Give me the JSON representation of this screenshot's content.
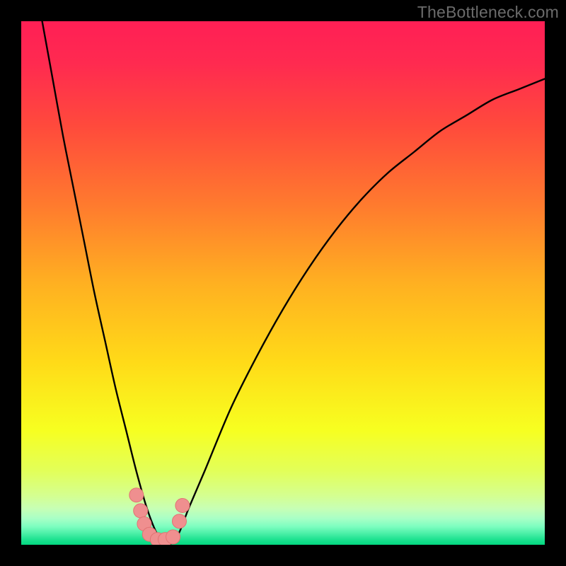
{
  "watermark": "TheBottleneck.com",
  "colors": {
    "frame": "#000000",
    "watermark": "#6b6b6b",
    "curve": "#000000",
    "marker_fill": "#ef8f8f",
    "marker_stroke": "#e17373",
    "gradient_stops": [
      {
        "offset": 0,
        "color": "#ff1f55"
      },
      {
        "offset": 0.08,
        "color": "#ff2a50"
      },
      {
        "offset": 0.2,
        "color": "#ff4a3c"
      },
      {
        "offset": 0.35,
        "color": "#ff7a2e"
      },
      {
        "offset": 0.5,
        "color": "#ffb021"
      },
      {
        "offset": 0.65,
        "color": "#ffda18"
      },
      {
        "offset": 0.78,
        "color": "#f7ff20"
      },
      {
        "offset": 0.86,
        "color": "#e2ff5a"
      },
      {
        "offset": 0.905,
        "color": "#d5ff8f"
      },
      {
        "offset": 0.93,
        "color": "#c8ffb4"
      },
      {
        "offset": 0.95,
        "color": "#a8ffc6"
      },
      {
        "offset": 0.965,
        "color": "#7dfec0"
      },
      {
        "offset": 0.978,
        "color": "#4df0a8"
      },
      {
        "offset": 0.99,
        "color": "#1de290"
      },
      {
        "offset": 1.0,
        "color": "#03d880"
      }
    ]
  },
  "chart_data": {
    "type": "line",
    "title": "",
    "xlabel": "",
    "ylabel": "",
    "xlim": [
      0,
      100
    ],
    "ylim": [
      0,
      100
    ],
    "note": "No axes or tick labels are shown; values are estimated from pixel positions. Minimum of the V-curve is at roughly x≈26 on a 0–100 horizontal scale.",
    "series": [
      {
        "name": "bottleneck-curve",
        "x": [
          4,
          6,
          8,
          10,
          12,
          14,
          16,
          18,
          20,
          22,
          24,
          26,
          28,
          30,
          32,
          35,
          40,
          45,
          50,
          55,
          60,
          65,
          70,
          75,
          80,
          85,
          90,
          95,
          100
        ],
        "y": [
          100,
          89,
          78,
          68,
          58,
          48,
          39,
          30,
          22,
          14,
          7,
          2,
          0,
          2,
          7,
          14,
          26,
          36,
          45,
          53,
          60,
          66,
          71,
          75,
          79,
          82,
          85,
          87,
          89
        ]
      }
    ],
    "markers": [
      {
        "x": 22.0,
        "y": 9.5
      },
      {
        "x": 22.8,
        "y": 6.5
      },
      {
        "x": 23.5,
        "y": 4.0
      },
      {
        "x": 24.5,
        "y": 2.0
      },
      {
        "x": 26.0,
        "y": 1.0
      },
      {
        "x": 27.5,
        "y": 1.0
      },
      {
        "x": 29.0,
        "y": 1.5
      },
      {
        "x": 30.2,
        "y": 4.5
      },
      {
        "x": 30.8,
        "y": 7.5
      }
    ]
  }
}
